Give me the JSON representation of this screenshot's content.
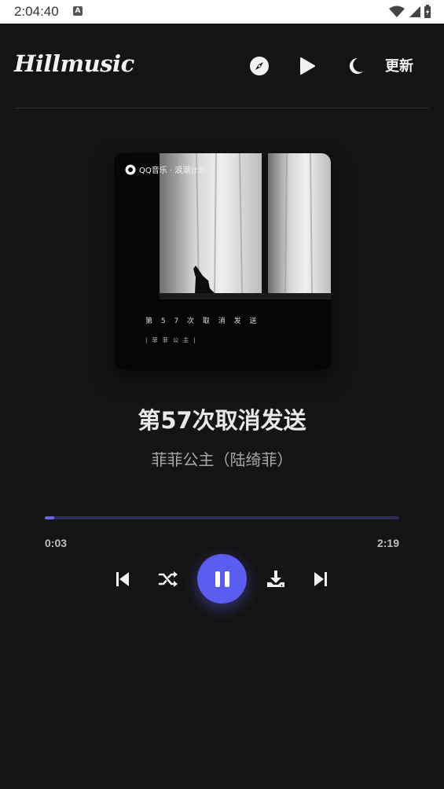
{
  "status_bar": {
    "time": "2:04:40",
    "app_icon_letter": "A"
  },
  "header": {
    "logo": "Hillmusic",
    "update_label": "更新",
    "icons": [
      "compass-icon",
      "play-icon",
      "moon-icon"
    ]
  },
  "cover": {
    "brand": "QQ音乐 · 浪潮计划",
    "title_text": "第 5 7 次 取 消 发 送",
    "artist_text": "| 菲 菲 公 主 |"
  },
  "song": {
    "title": "第57次取消发送",
    "artist": "菲菲公主（陆绮菲）"
  },
  "player": {
    "current_time": "0:03",
    "total_time": "2:19",
    "progress_fraction": 0.027,
    "accent_color": "#5b5cf0",
    "controls": [
      "previous-icon",
      "shuffle-icon",
      "pause-icon",
      "download-icon",
      "next-icon"
    ]
  }
}
